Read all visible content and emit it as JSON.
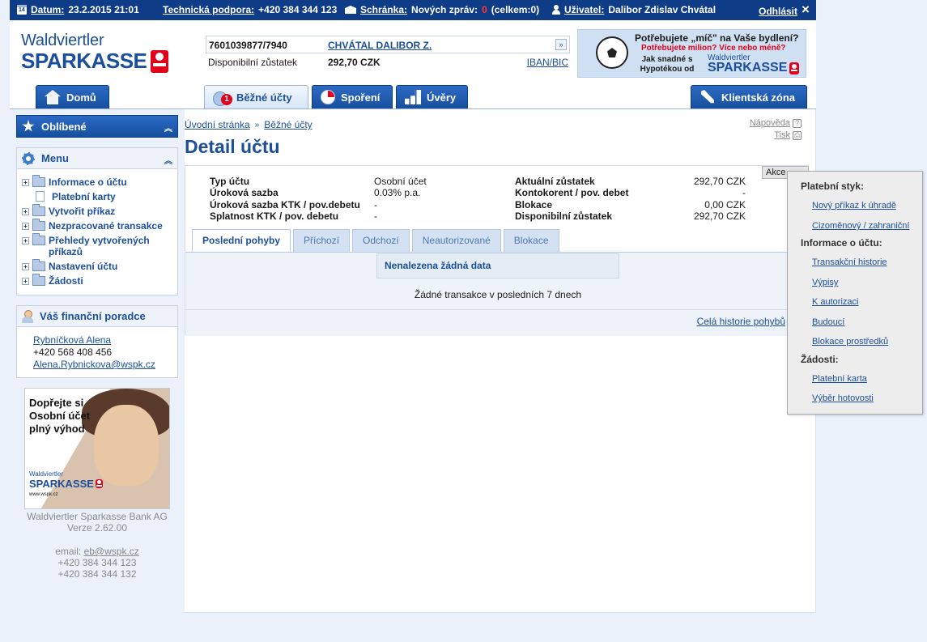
{
  "topbar": {
    "date_label": "Datum:",
    "date_value": "23.2.2015 21:01",
    "support_label": "Technická podpora:",
    "support_value": "+420 384 344 123",
    "inbox_label": "Schránka:",
    "inbox_text": "Nových zpráv:",
    "inbox_new": "0",
    "inbox_total": "(celkem:0)",
    "user_label": "Uživatel:",
    "user_name": "Dalibor Zdislav Chvátal",
    "logout": "Odhlásit",
    "close": "×"
  },
  "logo": {
    "line1": "Waldviertler",
    "line2": "SPARKASSE"
  },
  "account": {
    "number": "7601039877/7940",
    "holder": "CHVÁTAL DALIBOR Z.",
    "balance_label": "Disponibilní zůstatek",
    "balance_value": "292,70 CZK",
    "iban": "IBAN/BIC"
  },
  "banner": {
    "line1": "Potřebujete „míč\" na Vaše bydlení?",
    "line2": "Potřebujete milion? Více nebo méně?",
    "line3": "Jak snadné s Hypotékou od",
    "brand1": "Waldviertler",
    "brand2": "SPARKASSE"
  },
  "nav": [
    {
      "label": "Domů"
    },
    {
      "label": "Běžné účty"
    },
    {
      "label": "Spoření"
    },
    {
      "label": "Úvěry"
    },
    {
      "label": "Klientská zóna"
    }
  ],
  "sidebar": {
    "favorites": "Oblíbené",
    "menu": "Menu",
    "menu_items": [
      "Informace o účtu",
      "Platební karty",
      "Vytvořit příkaz",
      "Nezpracované transakce",
      "Přehledy vytvořených příkazů",
      "Nastavení účtu",
      "Žádosti"
    ],
    "advisor_title": "Váš finanční poradce",
    "advisor_name": "Rybníčková Alena",
    "advisor_phone": "+420 568 408 456",
    "advisor_email": "Alena.Rybnickova@wspk.cz",
    "promo_text": "Dopřejte si Osobní účet plný výhod",
    "promo_brand1": "Waldviertler",
    "promo_brand2": "SPARKASSE",
    "promo_url": "www.wspk.cz",
    "footer_bank": "Waldviertler Sparkasse Bank AG",
    "footer_version": "Verze 2.62.00",
    "footer_email_label": "email:",
    "footer_email": "eb@wspk.cz",
    "footer_phone1": "+420 384 344 123",
    "footer_phone2": "+420 384 344 132"
  },
  "breadcrumb": {
    "home": "Úvodní stránka",
    "sep": "»",
    "current": "Běžné účty"
  },
  "page_title": "Detail účtu",
  "help": {
    "help": "Nápověda",
    "print": "Tisk"
  },
  "details": {
    "left": [
      {
        "label": "Typ účtu",
        "value": "Osobní účet"
      },
      {
        "label": "Úroková sazba",
        "value": "0.03% p.a."
      },
      {
        "label": "Úroková sazba KTK / pov.debetu",
        "value": "-"
      },
      {
        "label": "Splatnost KTK / pov. debetu",
        "value": "-"
      }
    ],
    "right": [
      {
        "label": "Aktuální zůstatek",
        "value": "292,70 CZK"
      },
      {
        "label": "Kontokorent / pov. debet",
        "value": "-"
      },
      {
        "label": "Blokace",
        "value": "0,00 CZK"
      },
      {
        "label": "Disponibilní zůstatek",
        "value": "292,70 CZK"
      }
    ],
    "actions": "Akce"
  },
  "tabs": [
    "Poslední pohyby",
    "Příchozí",
    "Odchozí",
    "Neautorizované",
    "Blokace"
  ],
  "nodata": {
    "header": "Nenalezena žádná data",
    "body": "Žádné transakce v posledních 7 dnech"
  },
  "full_history": "Celá historie pohybů",
  "context_menu": {
    "group1": "Platební styk:",
    "g1_items": [
      "Nový příkaz k úhradě",
      "Cizoměnový / zahraniční"
    ],
    "group2": "Informace o účtu:",
    "g2_items": [
      "Transakční historie",
      "Výpisy",
      "K autorizaci",
      "Budoucí",
      "Blokace prostředků"
    ],
    "group3": "Žádosti:",
    "g3_items": [
      "Platební karta",
      "Výběr hotovosti"
    ]
  },
  "colors": {
    "brand": "#1b4f9c",
    "topbar": "#0f3c86",
    "accent_red": "#e2001a"
  }
}
